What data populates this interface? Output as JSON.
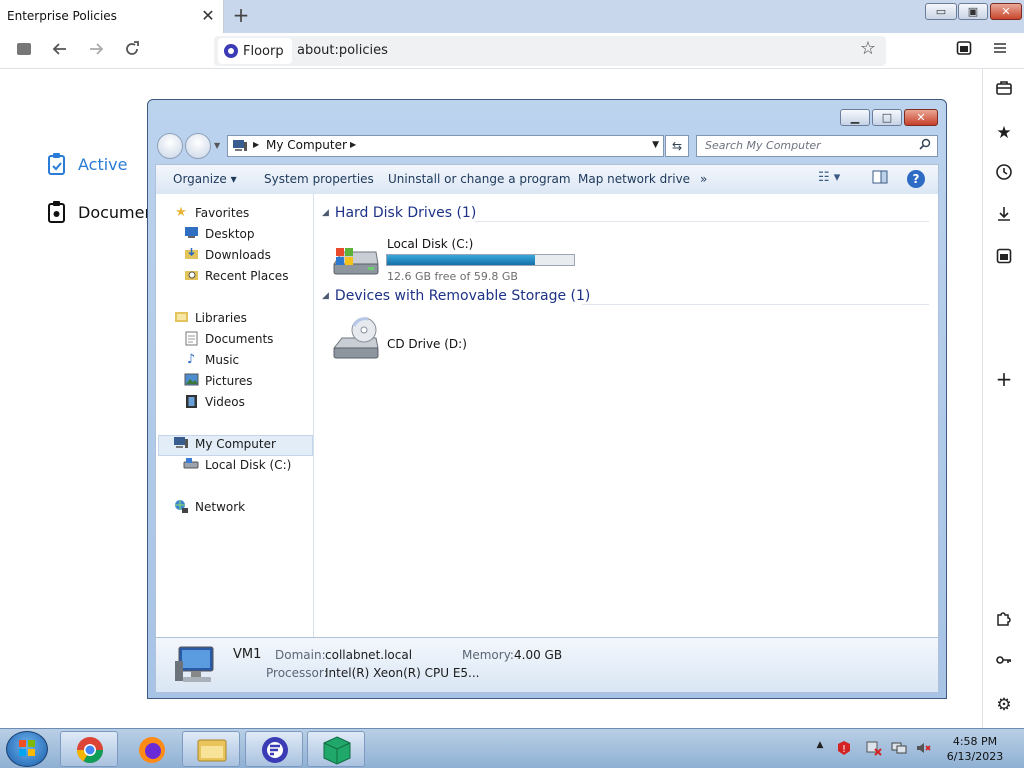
{
  "browser": {
    "tab": {
      "title": "Enterprise Policies",
      "close": "✕"
    },
    "new_tab": "+",
    "window_controls": {
      "minimize": "▭",
      "maximize": "▣",
      "close": "✕"
    },
    "url_chip_label": "Floorp",
    "url": "about:policies"
  },
  "policies_page": {
    "items": [
      {
        "label": "Active",
        "color": "#2a7cd6"
      },
      {
        "label": "Documen",
        "color": "#111111"
      }
    ]
  },
  "explorer": {
    "address": {
      "root": "My Computer"
    },
    "search": {
      "placeholder": "Search My Computer"
    },
    "commands": [
      "Organize",
      "System properties",
      "Uninstall or change a program",
      "Map network drive",
      "»"
    ],
    "nav": {
      "favorites": {
        "title": "Favorites",
        "items": [
          "Desktop",
          "Downloads",
          "Recent Places"
        ]
      },
      "libraries": {
        "title": "Libraries",
        "items": [
          "Documents",
          "Music",
          "Pictures",
          "Videos"
        ]
      },
      "computer": {
        "title": "My Computer",
        "items": [
          "Local Disk (C:)"
        ]
      },
      "network": {
        "title": "Network"
      }
    },
    "groups": [
      {
        "title": "Hard Disk Drives (1)",
        "drives": [
          {
            "name": "Local Disk (C:)",
            "free_text": "12.6 GB free of 59.8 GB",
            "used_fraction": 0.79
          }
        ]
      },
      {
        "title": "Devices with Removable Storage (1)",
        "drives": [
          {
            "name": "CD Drive (D:)"
          }
        ]
      }
    ],
    "details": {
      "computer_name": "VM1",
      "domain_label": "Domain:",
      "domain_value": "collabnet.local",
      "memory_label": "Memory:",
      "memory_value": "4.00 GB",
      "processor_label": "Processor:",
      "processor_value": "Intel(R) Xeon(R) CPU E5..."
    }
  },
  "taskbar": {
    "time": "4:58 PM",
    "date": "6/13/2023"
  }
}
